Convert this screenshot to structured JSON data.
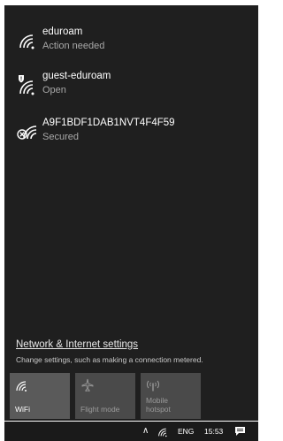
{
  "networks": [
    {
      "ssid": "eduroam",
      "status": "Action needed",
      "icon": "wifi-icon"
    },
    {
      "ssid": "guest-eduroam",
      "status": "Open",
      "icon": "wifi-shield-icon"
    },
    {
      "ssid": "A9F1BDF1DAB1NVT4F4F59",
      "status": "Secured",
      "icon": "wifi-secured-icon"
    }
  ],
  "settings": {
    "link": "Network & Internet settings",
    "description": "Change settings, such as making a connection metered."
  },
  "tiles": [
    {
      "label": "WiFi",
      "state": "on",
      "icon": "wifi-icon"
    },
    {
      "label": "Flight mode",
      "state": "off",
      "icon": "airplane-icon"
    },
    {
      "label": "Mobile hotspot",
      "state": "off",
      "icon": "hotspot-icon"
    }
  ],
  "taskbar": {
    "language": "ENG",
    "time": "15:53"
  },
  "colors": {
    "panel_bg": "#1f1f1f",
    "tile_bg": "#4a4a4a",
    "status_text": "#a8a8a8"
  }
}
